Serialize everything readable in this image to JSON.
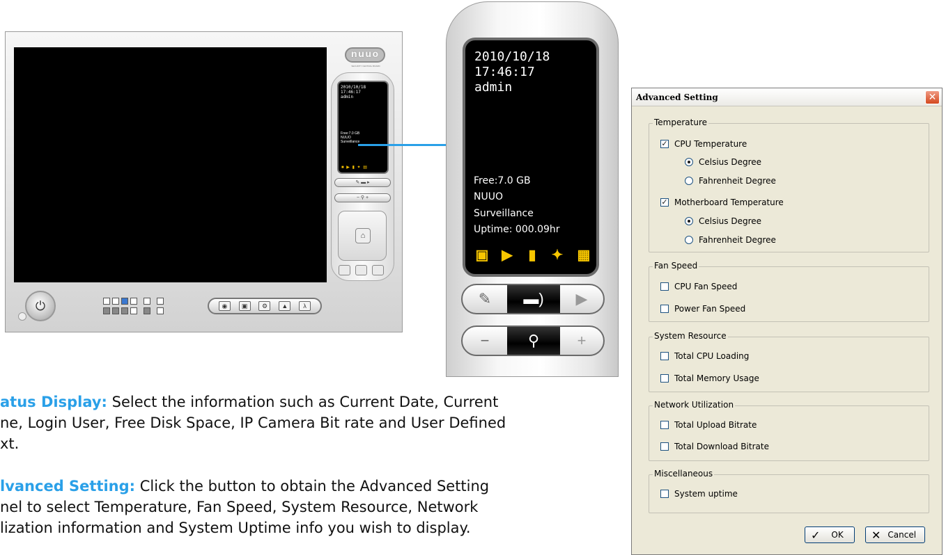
{
  "console": {
    "logo": "nuuo",
    "logo_sub": "SECURITY CENTRAL BOARD",
    "lcd_date": "2010/10/18",
    "lcd_time": "17:46:17",
    "lcd_user": "admin",
    "lcd_free": "Free:7.0 GB",
    "lcd_line2": "NUUO",
    "lcd_line3": "Surveillance"
  },
  "status_display": {
    "date": "2010/10/18",
    "time": "17:46:17",
    "user": "admin",
    "free": "Free:7.0 GB",
    "text1": "NUUO",
    "text2": "Surveillance",
    "uptime": "Uptime: 000.09hr",
    "accent_color": "#f7c600"
  },
  "dialog": {
    "title": "Advanced Setting",
    "groups": {
      "temperature": "Temperature",
      "fan_speed": "Fan Speed",
      "system_resource": "System Resource",
      "network": "Network Utilization",
      "misc": "Miscellaneous"
    },
    "options": {
      "cpu_temp": "CPU Temperature",
      "cpu_celsius": "Celsius Degree",
      "cpu_fahrenheit": "Fahrenheit Degree",
      "mb_temp": "Motherboard Temperature",
      "mb_celsius": "Celsius Degree",
      "mb_fahrenheit": "Fahrenheit Degree",
      "cpu_fan": "CPU Fan Speed",
      "power_fan": "Power Fan Speed",
      "cpu_loading": "Total CPU Loading",
      "memory_usage": "Total Memory Usage",
      "upload": "Total Upload Bitrate",
      "download": "Total Download Bitrate",
      "uptime": "System uptime"
    },
    "ok_label": "OK",
    "cancel_label": "Cancel"
  },
  "text": {
    "p1_key": "atus Display:",
    "p1_l1": " Select the information such as Current Date, Current",
    "p1_l2": "ne, Login User, Free Disk Space, IP Camera Bit rate and User Defined",
    "p1_l3": "xt.",
    "p2_key": "lvanced Setting:",
    "p2_l1": " Click the button to obtain the Advanced Setting",
    "p2_l2": "nel to select Temperature, Fan Speed, System Resource, Network",
    "p2_l3": "lization information and System Uptime info you wish to display."
  },
  "colors": {
    "accent_blue": "#2aa0e8",
    "dialog_bg": "#ece9d8"
  }
}
